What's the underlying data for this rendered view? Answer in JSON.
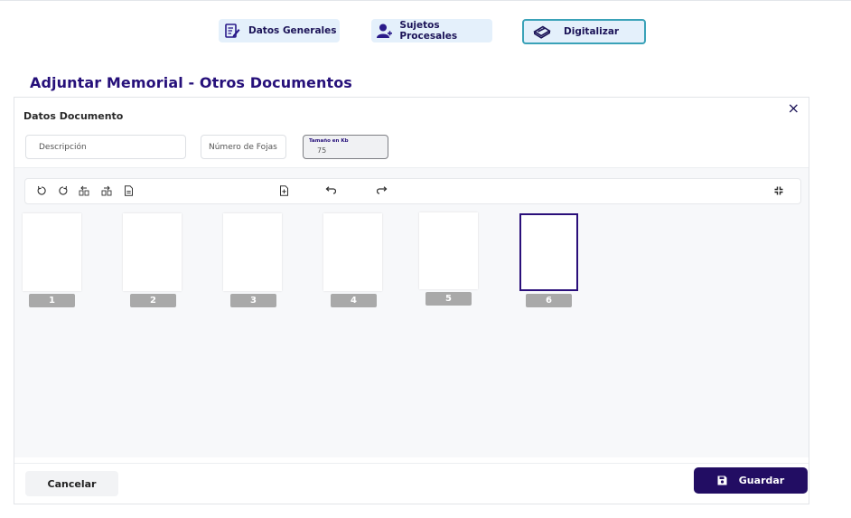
{
  "tabs": [
    {
      "label": "Datos Generales",
      "icon": "edit-document-icon"
    },
    {
      "label": "Sujetos Procesales",
      "icon": "add-user-icon"
    },
    {
      "label": "Digitalizar",
      "icon": "scanner-icon",
      "active": true
    }
  ],
  "page_title": "Adjuntar Memorial - Otros Documentos",
  "section_title": "Datos Documento",
  "close_icon": "×",
  "fields": {
    "descripcion": {
      "placeholder": "Descripción",
      "value": ""
    },
    "fojas": {
      "placeholder": "Número de Fojas",
      "value": ""
    },
    "tamano": {
      "label": "Tamaño en Kb",
      "value": "75"
    }
  },
  "toolbar": {
    "icons": [
      "rotate-left-icon",
      "rotate-right-icon",
      "move-left-icon",
      "move-right-icon",
      "document-icon",
      "add-page-icon",
      "undo-icon",
      "redo-icon",
      "collapse-icon"
    ]
  },
  "pages": [
    "1",
    "2",
    "3",
    "4",
    "5",
    "6"
  ],
  "selected_page": "6",
  "buttons": {
    "cancel": "Cancelar",
    "save": "Guardar"
  },
  "colors": {
    "primary": "#220d63",
    "title": "#26107a",
    "tab_bg": "#e4f0fb",
    "active_tab_border": "#3aa2b8",
    "page_number_bg": "#a9a9a9"
  }
}
